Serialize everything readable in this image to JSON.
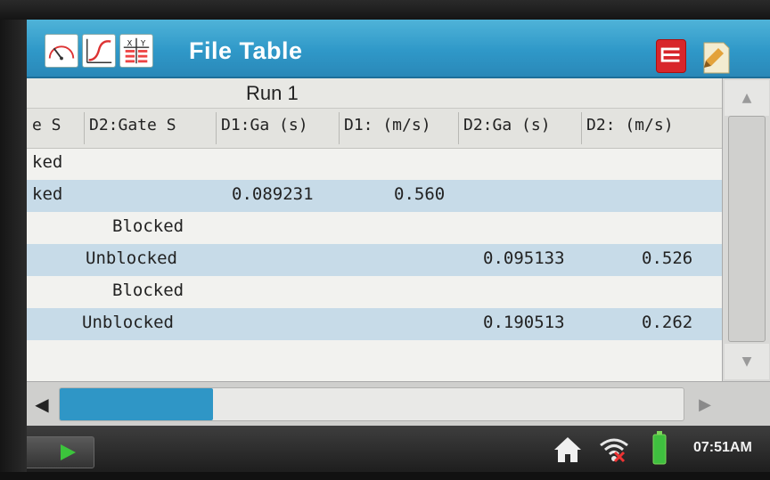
{
  "window": {
    "title": "File Table"
  },
  "toolbar": {
    "tabs": [
      "meter-icon",
      "graph-icon",
      "table-icon"
    ],
    "table_icon_text": "X|Y",
    "colors": {
      "titlebar": "#2f98c8",
      "row_alt": "#c7dbe8",
      "notes_button": "#d8262b"
    }
  },
  "table": {
    "run_label": "Run 1",
    "headers": [
      "e S",
      "D2:Gate S",
      "D1:Ga (s)",
      "D1: (m/s)",
      "D2:Ga (s)",
      "D2: (m/s)"
    ],
    "rows": [
      [
        "ked",
        "",
        "",
        "",
        "",
        ""
      ],
      [
        "ked",
        "",
        "0.089231",
        "0.560",
        "",
        ""
      ],
      [
        "",
        "Blocked",
        "",
        "",
        "",
        ""
      ],
      [
        "",
        "Unblocked",
        "",
        "",
        "0.095133",
        "0.526"
      ],
      [
        "",
        "Blocked",
        "",
        "",
        "",
        ""
      ],
      [
        "",
        "Unblocked",
        "",
        "",
        "0.190513",
        "0.262"
      ]
    ]
  },
  "horizontal_scroll": {
    "position": 0.0
  },
  "status_bar": {
    "time": "07:51AM"
  }
}
